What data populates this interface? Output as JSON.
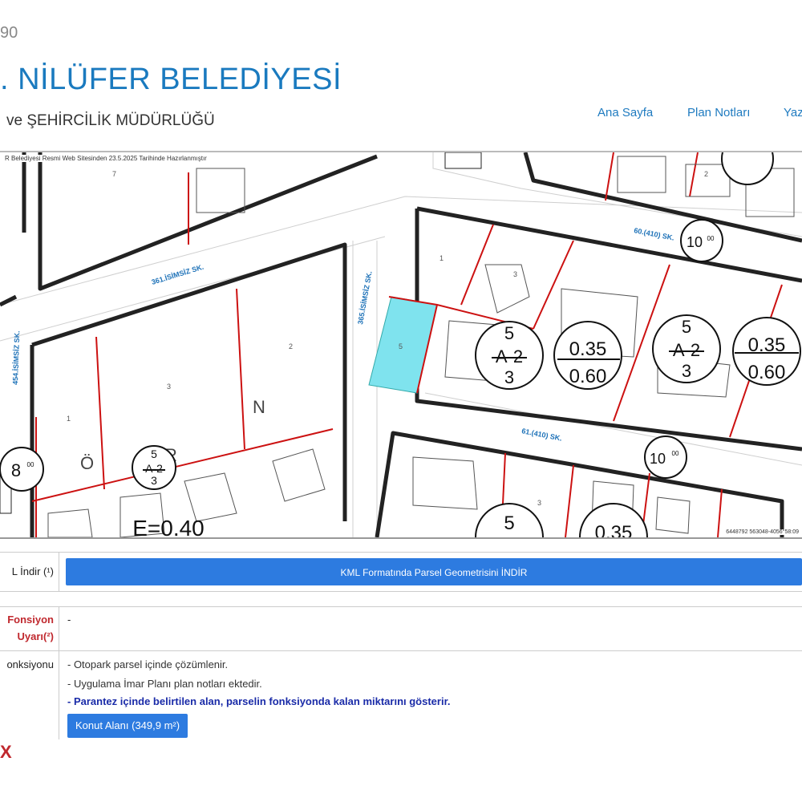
{
  "header": {
    "number_fragment": "90",
    "title": ". NİLÜFER BELEDİYESİ",
    "subtitle": "ve ŞEHİRCİLİK MÜDÜRLÜĞÜ",
    "nav": [
      "Ana Sayfa",
      "Plan Notları",
      "Yaz"
    ]
  },
  "map": {
    "header_text": "R Belediyesi Resmi Web Sitesinden 23.5.2025 Tarihinde Hazırlanmıştır",
    "coords_text": "6448792 563048-4056°58:09",
    "streets": [
      "361.İSİMSİZ SK.",
      "365.İSİMSİZ SK.",
      "454.İSİMSİZ SK.",
      "60.(410) SK.",
      "61.(410) SK."
    ],
    "parcel_numbers": [
      "7",
      "1",
      "3",
      "2",
      "1",
      "5",
      "3",
      "2",
      "3",
      "3"
    ],
    "zoning_labels": {
      "a_top": "5",
      "a_mid": "A-2",
      "a_bot": "3",
      "ratio_top": "0.35",
      "ratio_bot": "0.60",
      "f_label": "E=0.40",
      "height_10": "10",
      "height_8": "8",
      "height_00": "00",
      "partial_5": "5",
      "partial_035": "0.35"
    },
    "map_letters": [
      "N",
      "Ö",
      "R"
    ],
    "selected_parcel_color": "#7fe3ee",
    "line_color": "#cc1111",
    "road_color": "#222222"
  },
  "info": {
    "kml_label": "L İndir (¹)",
    "kml_button": "KML Formatında Parsel Geometrisini İNDİR",
    "warn_label_1": "Fonsiyon",
    "warn_label_2": "Uyarı(²)",
    "warn_value": "-",
    "func_label": "onksiyonu",
    "func_lines": [
      "- Otopark parsel içinde çözümlenir.",
      "- Uygulama İmar Planı plan notları ektedir.",
      "- Parantez içinde belirtilen alan, parselin fonksiyonda kalan miktarını gösterir."
    ],
    "konut_button": "Konut Alanı (349,9 m²)",
    "x_mark": "X"
  }
}
